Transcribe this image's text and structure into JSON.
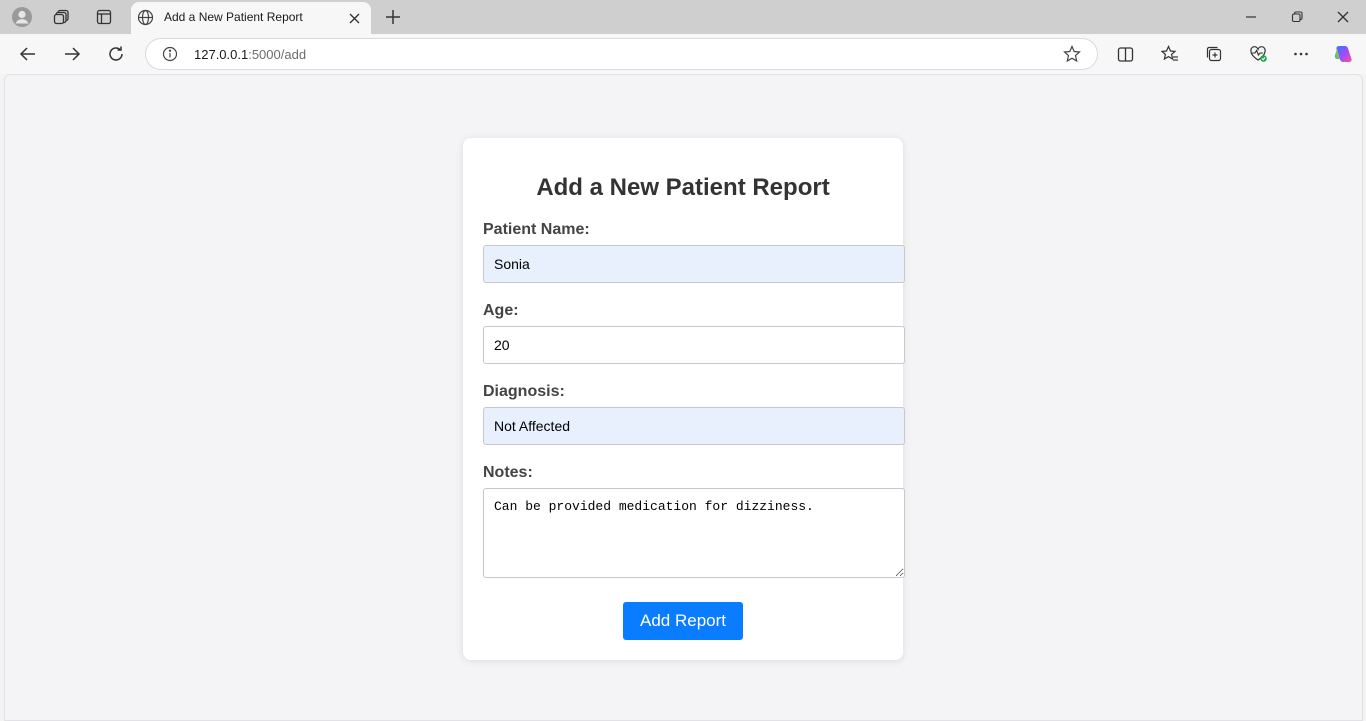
{
  "browser": {
    "tab_title": "Add a New Patient Report",
    "url_host": "127.0.0.1",
    "url_path": ":5000/add"
  },
  "page": {
    "title": "Add a New Patient Report",
    "form": {
      "name_label": "Patient Name:",
      "name_value": "Sonia",
      "age_label": "Age:",
      "age_value": "20",
      "diagnosis_label": "Diagnosis:",
      "diagnosis_value": "Not Affected",
      "notes_label": "Notes:",
      "notes_value": "Can be provided medication for dizziness.",
      "submit_label": "Add Report"
    }
  },
  "colors": {
    "primary_button": "#0a7cff",
    "autofill_bg": "#e8f0fe",
    "page_bg": "#f4f4f7"
  }
}
